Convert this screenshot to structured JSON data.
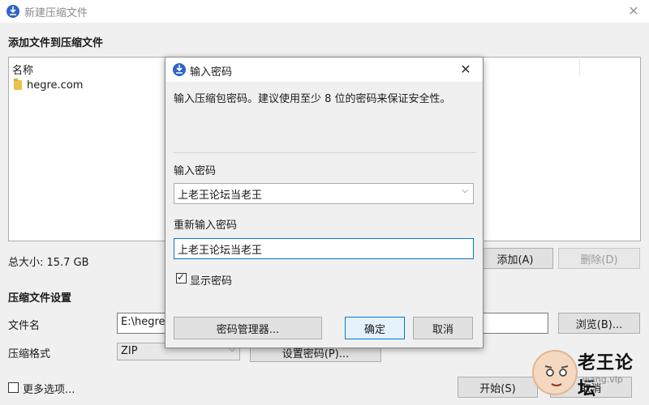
{
  "window": {
    "title": "新建压缩文件",
    "close_glyph": "✕"
  },
  "add_section": {
    "heading": "添加文件到压缩文件",
    "column_name": "名称",
    "items": [
      {
        "name": "hegre.com",
        "icon": "folder-icon"
      }
    ],
    "total_size": "总大小: 15.7 GB",
    "add_button": "添加(A)",
    "delete_button": "删除(D)"
  },
  "settings_section": {
    "heading": "压缩文件设置",
    "filename_label": "文件名",
    "filename_value": "E:\\hegre.c",
    "browse_button": "浏览(B)...",
    "format_label": "压缩格式",
    "format_value": "ZIP",
    "set_password_button": "设置密码(P)...",
    "more_options_label": "更多选项...",
    "start_button": "开始(S)",
    "cancel_button": "取消"
  },
  "dialog": {
    "title": "输入密码",
    "close_glyph": "✕",
    "description": "输入压缩包密码。建议使用至少 8 位的密码来保证安全性。",
    "password_label": "输入密码",
    "password_value": "上老王论坛当老王",
    "reenter_label": "重新输入密码",
    "reenter_value": "上老王论坛当老王",
    "show_password_label": "显示密码",
    "show_password_checked": true,
    "password_manager_button": "密码管理器...",
    "ok_button": "确定",
    "cancel_button": "取消"
  },
  "watermark": {
    "text": "老王论坛",
    "sub": "wang.vip"
  },
  "colors": {
    "accent": "#0078d7",
    "app_icon": "#2f63c6"
  }
}
